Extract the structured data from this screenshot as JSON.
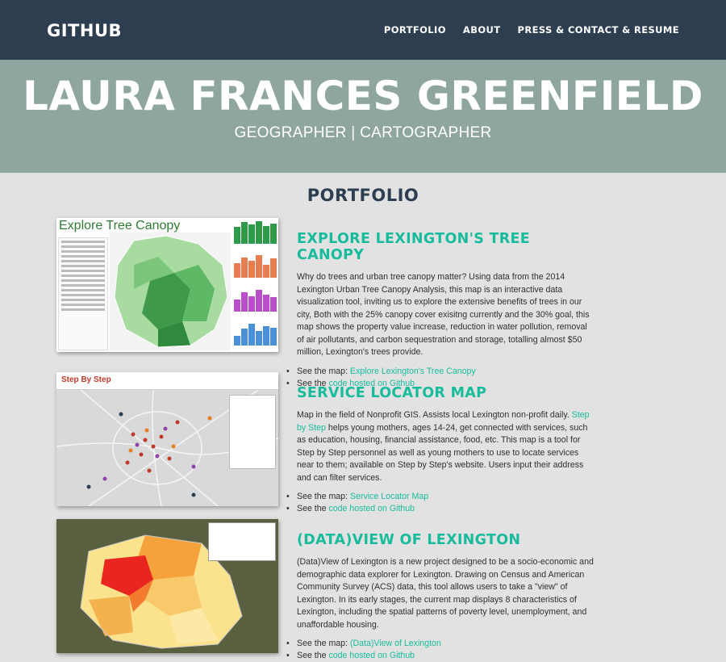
{
  "nav": {
    "brand": "GITHUB",
    "links": [
      "PORTFOLIO",
      "ABOUT",
      "PRESS & CONTACT & RESUME"
    ]
  },
  "hero": {
    "title": "LAURA FRANCES GREENFIELD",
    "subtitle": "GEOGRAPHER | CARTOGRAPHER"
  },
  "portfolio": {
    "heading": "PORTFOLIO",
    "projects": [
      {
        "title": "EXPLORE LEXINGTON'S TREE CANOPY",
        "thumb_label": "Explore Tree Canopy",
        "desc": "Why do trees and urban tree canopy matter? Using data from the 2014 Lexington Urban Tree Canopy Analysis, this map is an interactive data visualization tool, inviting us to explore the extensive benefits of trees in our city, Both with the 25% canopy cover exisitng currently and the 30% goal, this map shows the property value increase, reduction in water pollution, removal of air pollutants, and carbon sequestration and storage, totalling almost $50 million, Lexington's trees provide.",
        "map_prefix": "See the map: ",
        "map_link": "Explore Lexington's Tree Canopy",
        "code_prefix": "See the ",
        "code_link": "code hosted on Github"
      },
      {
        "title": "SERVICE LOCATOR MAP",
        "thumb_label": "Step By Step",
        "desc_before": "Map in the field of Nonprofit GIS. Assists local Lexington non-profit daily. ",
        "desc_link": "Step by Step",
        "desc_after": " helps young mothers, ages 14-24, get connected with services, such as education, housing, financial assistance, food, etc. This map is a tool for Step by Step personnel as well as young mothers to use to locate services near to them; available on Step by Step's website. Users input their address and can filter services.",
        "map_prefix": "See the map: ",
        "map_link": "Service Locator Map",
        "code_prefix": "See the ",
        "code_link": "code hosted on Github"
      },
      {
        "title": "(DATA)VIEW OF LEXINGTON",
        "desc": "(Data)View of Lexington is a new project designed to be a socio-economic and demographic data explorer for Lexington. Drawing on Census and American Community Survey (ACS) data, this tool allows users to take a \"view\" of Lexington. In its early stages, the current map displays 8 characteristics of Lexington, including the spatial patterns of poverty level, unemployment, and unaffordable housing.",
        "map_prefix": "See the map: ",
        "map_link": "(Data)View of Lexington",
        "code_prefix": "See the ",
        "code_link": "code hosted on Github"
      }
    ]
  },
  "colors": {
    "nav_bg": "#2c3e50",
    "hero_bg": "#8fa5a0",
    "accent": "#18bc9c",
    "page_bg": "#e2e2e2"
  }
}
